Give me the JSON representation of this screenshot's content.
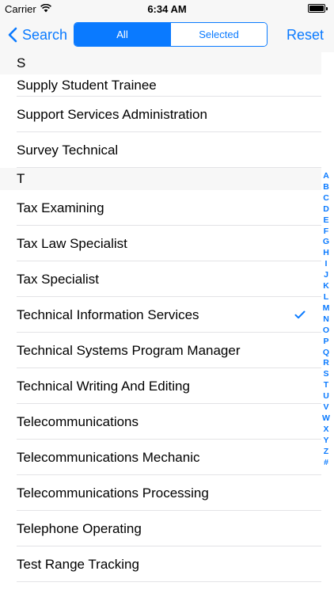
{
  "status": {
    "carrier": "Carrier",
    "time": "6:34 AM",
    "wifi_icon": "wifi-icon",
    "battery_icon": "battery-icon"
  },
  "nav": {
    "back_label": "Search",
    "segments": [
      "All",
      "Selected"
    ],
    "active_segment": "All",
    "reset_label": "Reset"
  },
  "list": {
    "section_s": "S",
    "s_items": [
      "Supply Student Trainee",
      "Support Services Administration",
      "Survey Technical"
    ],
    "section_t": "T",
    "t_items": [
      "Tax Examining",
      "Tax Law Specialist",
      "Tax Specialist",
      "Technical Information Services",
      "Technical Systems Program Manager",
      "Technical Writing And Editing",
      "Telecommunications",
      "Telecommunications Mechanic",
      "Telecommunications Processing",
      "Telephone Operating",
      "Test Range Tracking"
    ],
    "checked_item": "Technical Information Services"
  },
  "index_letters": [
    "A",
    "B",
    "C",
    "D",
    "E",
    "F",
    "G",
    "H",
    "I",
    "J",
    "K",
    "L",
    "M",
    "N",
    "O",
    "P",
    "Q",
    "R",
    "S",
    "T",
    "U",
    "V",
    "W",
    "X",
    "Y",
    "Z",
    "#"
  ],
  "colors": {
    "accent": "#0a7aff",
    "header_bg": "#f7f7f7",
    "separator": "#e3e3e6"
  }
}
